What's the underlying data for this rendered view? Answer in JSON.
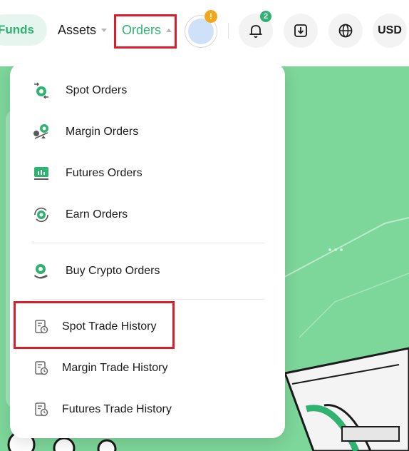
{
  "nav": {
    "funds_label": "Funds",
    "assets_label": "Assets",
    "orders_label": "Orders",
    "warning_badge": "!",
    "notification_count": "2",
    "currency_label": "USD"
  },
  "orders_menu": {
    "items": [
      {
        "label": "Spot Orders",
        "icon": "spot-orders-icon"
      },
      {
        "label": "Margin Orders",
        "icon": "margin-orders-icon"
      },
      {
        "label": "Futures Orders",
        "icon": "futures-orders-icon"
      },
      {
        "label": "Earn Orders",
        "icon": "earn-orders-icon"
      },
      {
        "label": "Buy Crypto Orders",
        "icon": "buy-crypto-icon"
      }
    ],
    "history": [
      {
        "label": "Spot Trade History",
        "icon": "history-icon"
      },
      {
        "label": "Margin Trade History",
        "icon": "history-icon"
      },
      {
        "label": "Futures Trade History",
        "icon": "history-icon"
      }
    ]
  },
  "colors": {
    "accent": "#2fb370",
    "banner": "#7dd69a",
    "highlight_box": "#d91d2a",
    "warning": "#f2a81d"
  }
}
